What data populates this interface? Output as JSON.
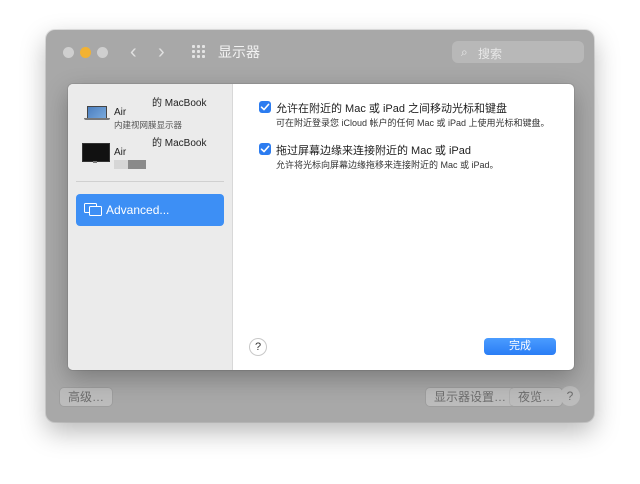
{
  "window": {
    "title": "显示器",
    "search_placeholder": "搜索",
    "bottom_buttons": {
      "advanced": "高级…",
      "display_settings": "显示器设置…",
      "night_shift": "夜览…",
      "help": "?"
    }
  },
  "sheet": {
    "sidebar": {
      "devices": [
        {
          "name_top": "的 MacBook",
          "name_air": "Air",
          "subtitle": "内建视网膜显示器",
          "icon": "laptop-icon"
        },
        {
          "name_top": "的 MacBook",
          "name_air": "Air",
          "subtitle": "",
          "icon": "laptop-dark-icon"
        }
      ],
      "advanced_label": "Advanced..."
    },
    "options": [
      {
        "checked": true,
        "title": "允许在附近的 Mac 或 iPad 之间移动光标和键盘",
        "desc": "可在附近登录您 iCloud 帐户的任何 Mac 或 iPad 上使用光标和键盘。"
      },
      {
        "checked": true,
        "title": "拖过屏幕边缘来连接附近的 Mac 或 iPad",
        "desc": "允许将光标向屏幕边缘拖移来连接附近的 Mac 或 iPad。"
      }
    ],
    "help": "?",
    "done": "完成"
  },
  "colors": {
    "accent": "#3d8ff5",
    "checkbox": "#2c7cf0",
    "window_dim": "#a8a8a8"
  }
}
